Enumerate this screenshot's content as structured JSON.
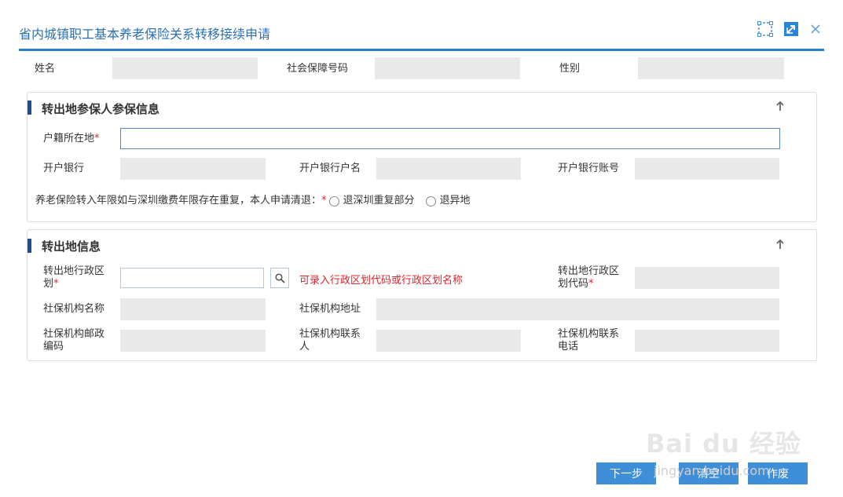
{
  "dialog": {
    "title": "省内城镇职工基本养老保险关系转移接续申请"
  },
  "person": {
    "name_label": "姓名",
    "ssn_label": "社会保障号码",
    "gender_label": "性别"
  },
  "section_out_insured": {
    "title": "转出地参保人参保信息",
    "hukou_label": "户籍所在地",
    "required_mark": "*",
    "bank_label": "开户银行",
    "account_name_label": "开户银行户名",
    "account_no_label": "开户银行账号",
    "refund_prompt": "养老保险转入年限如与深圳缴费年限存在重复，本人申请清退：",
    "refund_prompt_mark": "*",
    "refund_options": [
      "退深圳重复部分",
      "退异地"
    ]
  },
  "section_out_region": {
    "title": "转出地信息",
    "region_label_line1": "转出地行政区",
    "region_label_line2": "划",
    "region_hint": "可录入行政区划代码或行政区划名称",
    "region_code_label_line1": "转出地行政区",
    "region_code_label_line2": "划代码",
    "org_name_label": "社保机构名称",
    "org_addr_label": "社保机构地址",
    "org_post_label_line1": "社保机构邮政",
    "org_post_label_line2": "编码",
    "org_contact_label_line1": "社保机构联系",
    "org_contact_label_line2": "人",
    "org_phone_label_line1": "社保机构联系",
    "org_phone_label_line2": "电话"
  },
  "buttons": {
    "next": "下一步",
    "clear": "清空",
    "cancel": "作废"
  },
  "watermark": {
    "brand": "Bai du 经验",
    "url": "jingyan.baidu.com"
  },
  "colors": {
    "accent": "#2a7fd0",
    "section_bar": "#1f4e96",
    "required": "#d9262c",
    "button": "#3f8fd8"
  }
}
